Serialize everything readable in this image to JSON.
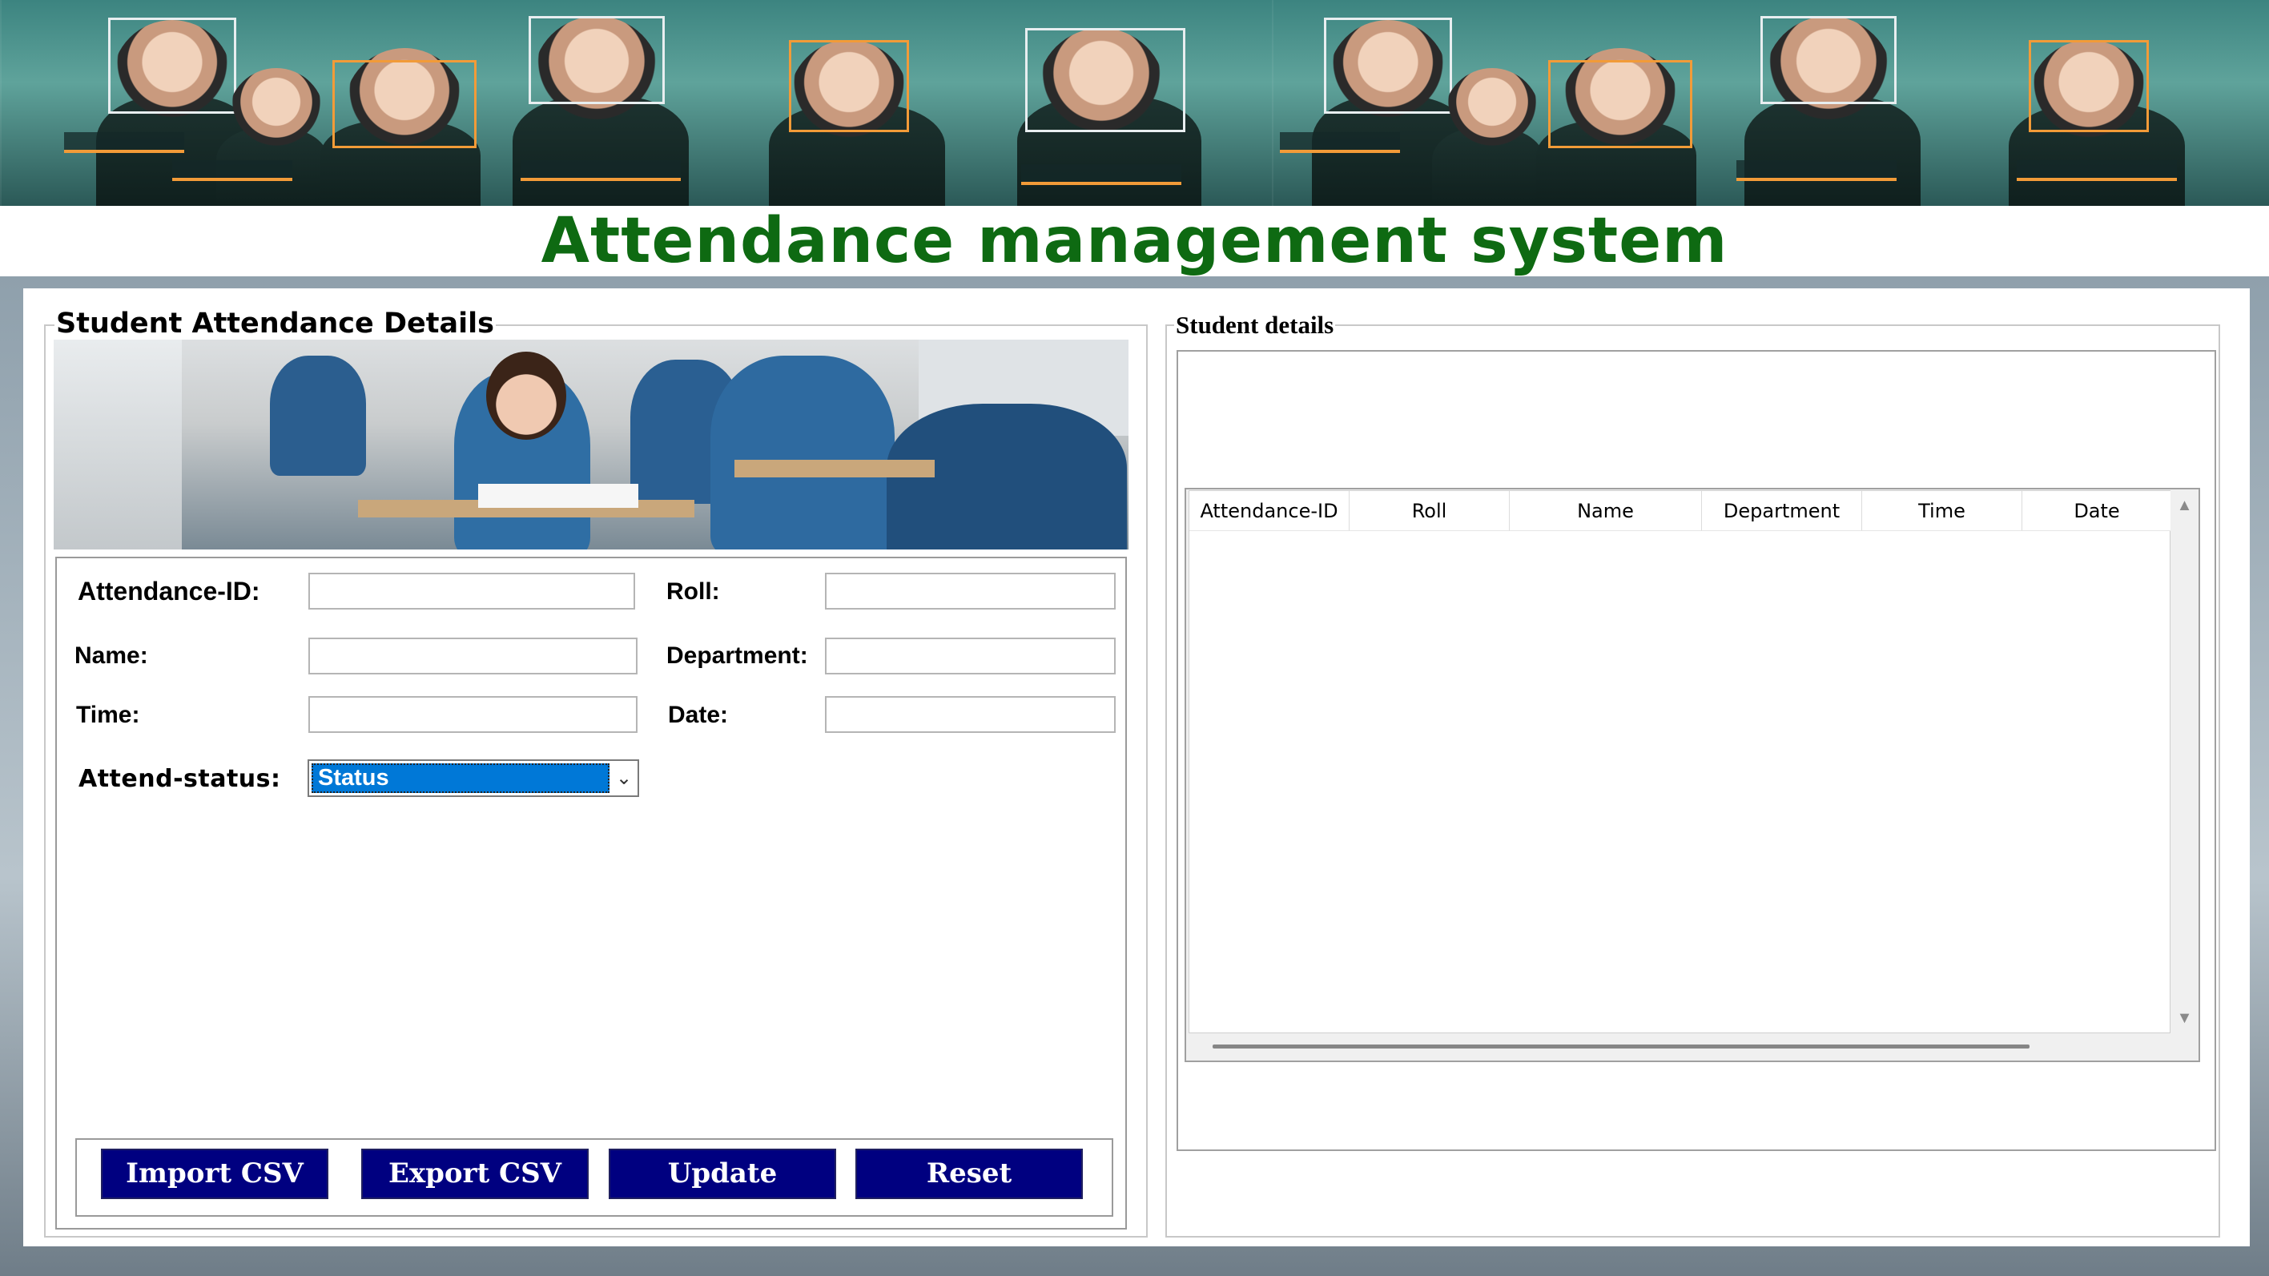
{
  "window": {
    "title": "Attendance management system"
  },
  "left_panel": {
    "title": "Student Attendance Details",
    "fields": {
      "attendance_id": {
        "label": "Attendance-ID:",
        "value": ""
      },
      "roll": {
        "label": "Roll:",
        "value": ""
      },
      "name": {
        "label": "Name:",
        "value": ""
      },
      "department": {
        "label": "Department:",
        "value": ""
      },
      "time": {
        "label": "Time:",
        "value": ""
      },
      "date": {
        "label": "Date:",
        "value": ""
      },
      "attend_status": {
        "label": "Attend-status:",
        "selected": "Status"
      }
    },
    "buttons": {
      "import_csv": "Import CSV",
      "export_csv": "Export CSV",
      "update": "Update",
      "reset": "Reset"
    }
  },
  "right_panel": {
    "title": "Student details",
    "table": {
      "columns": [
        "Attendance-ID",
        "Roll",
        "Name",
        "Department",
        "Time",
        "Date"
      ],
      "rows": []
    }
  },
  "colors": {
    "title_green": "#0e6a12",
    "button_navy": "#000080",
    "select_highlight": "#0078d7",
    "banner_accent": "#f29b38"
  },
  "icons": {
    "dropdown_arrow": "chevron-down-icon",
    "scroll_up": "triangle-up-icon",
    "scroll_down": "triangle-down-icon"
  }
}
